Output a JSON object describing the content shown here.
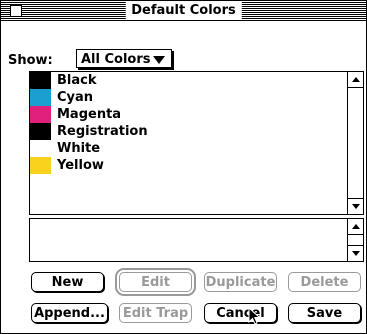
{
  "window": {
    "title": "Default Colors"
  },
  "show": {
    "label": "Show:",
    "selected": "All Colors"
  },
  "colors": [
    {
      "name": "Black",
      "swatch": "#000000"
    },
    {
      "name": "Cyan",
      "swatch": "#1a9fd0"
    },
    {
      "name": "Magenta",
      "swatch": "#e0207a"
    },
    {
      "name": "Registration",
      "swatch": "#000000"
    },
    {
      "name": "White",
      "swatch": "#ffffff"
    },
    {
      "name": "Yellow",
      "swatch": "#f8d21c"
    }
  ],
  "buttons": {
    "new": "New",
    "edit": "Edit",
    "duplicate": "Duplicate",
    "delete": "Delete",
    "append": "Append...",
    "edit_trap": "Edit Trap",
    "cancel": "Cancel",
    "save": "Save"
  }
}
